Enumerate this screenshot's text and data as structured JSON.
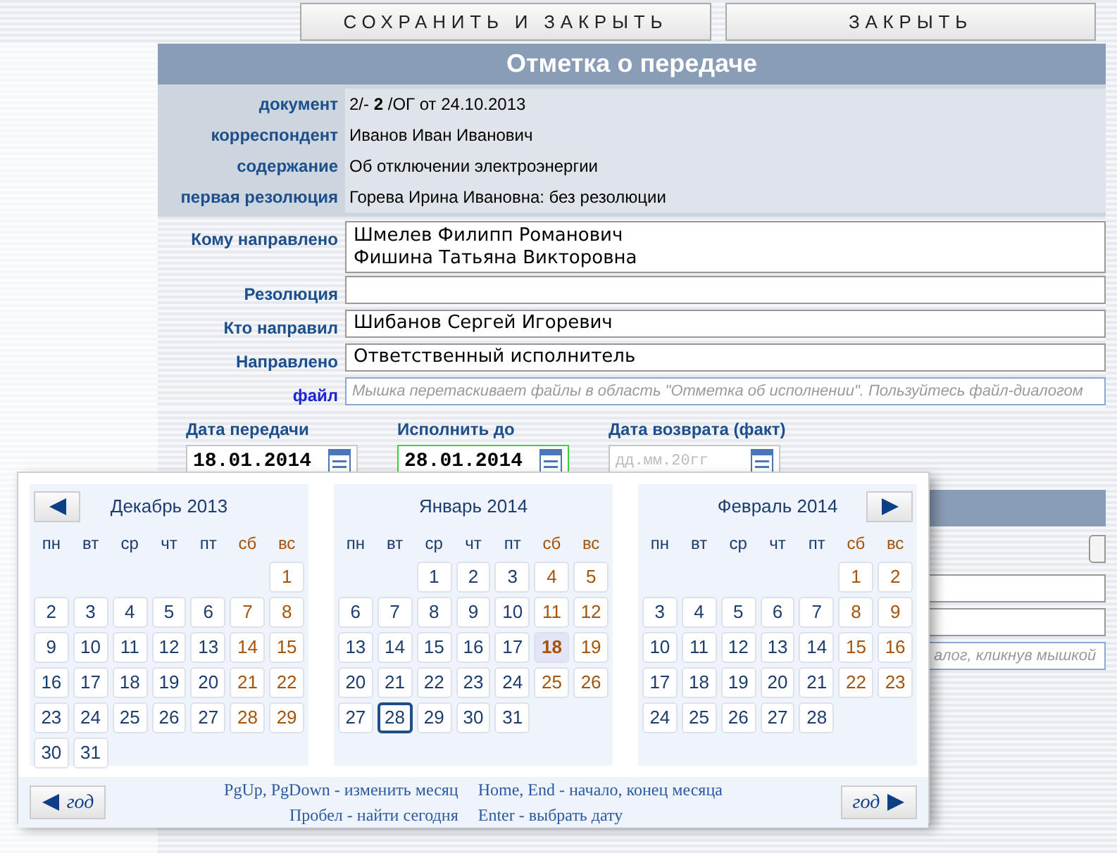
{
  "toolbar": {
    "buttons": [
      "СОХРАНИТЬ И ЗАКРЫТЬ",
      "ЗАКРЫТЬ"
    ]
  },
  "panel": {
    "title": "Отметка о передаче"
  },
  "info": [
    {
      "label": "документ",
      "value": "2/- **2** /ОГ от 24.10.2013"
    },
    {
      "label": "корреспондент",
      "value": "Иванов Иван Иванович"
    },
    {
      "label": "содержание",
      "value": "Об отключении электроэнергии"
    },
    {
      "label": "первая резолюция",
      "value": "Горева Ирина Ивановна: без резолюции"
    }
  ],
  "form": [
    {
      "label": "Кому направлено",
      "kind": "textarea",
      "lines": [
        "Шмелев Филипп Романович",
        "Фишина Татьяна Викторовна"
      ]
    },
    {
      "label": "Резолюция",
      "kind": "input"
    },
    {
      "label": "Кто направил",
      "kind": "input",
      "value": "Шибанов Сергей Игоревич"
    },
    {
      "label": "Направлено",
      "kind": "input",
      "value": "Ответственный исполнитель"
    },
    {
      "label": "файл",
      "kind": "file",
      "placeholder": "Мышка перетаскивает файлы в область \"Отметка об исполнении\". Пользуйтесь файл-диалогом"
    }
  ],
  "dates": [
    {
      "label": "Дата передачи",
      "value": "18.01.2014",
      "focused": false
    },
    {
      "label": "Исполнить до",
      "value": "28.01.2014",
      "focused": true
    },
    {
      "label": "Дата возврата (факт)",
      "placeholder": "дд.мм.20гг",
      "focused": false
    }
  ],
  "lower_section": {
    "file_placeholder_tail": "алог, кликнув мышкой"
  },
  "calendar": {
    "months": [
      {
        "title": "Декабрь 2013",
        "weekdays": [
          {
            "label": "пн",
            "weekend": false
          },
          {
            "label": "вт",
            "weekend": false
          },
          {
            "label": "ср",
            "weekend": false
          },
          {
            "label": "чт",
            "weekend": false
          },
          {
            "label": "пт",
            "weekend": false
          },
          {
            "label": "сб",
            "weekend": true
          },
          {
            "label": "вс",
            "weekend": true
          }
        ],
        "days": [
          {
            "kind": "empty"
          },
          {
            "kind": "empty"
          },
          {
            "kind": "empty"
          },
          {
            "kind": "empty"
          },
          {
            "kind": "empty"
          },
          {
            "kind": "empty"
          },
          {
            "day": "1",
            "selected": false,
            "today": false
          },
          {
            "day": "2",
            "selected": false,
            "today": false
          },
          {
            "day": "3",
            "selected": false,
            "today": false
          },
          {
            "day": "4",
            "selected": false,
            "today": false
          },
          {
            "day": "5",
            "selected": false,
            "today": false
          },
          {
            "day": "6",
            "selected": false,
            "today": false
          },
          {
            "day": "7",
            "selected": false,
            "today": false
          },
          {
            "day": "8",
            "selected": false,
            "today": false
          },
          {
            "day": "9",
            "selected": false,
            "today": false
          },
          {
            "day": "10",
            "selected": false,
            "today": false
          },
          {
            "day": "11",
            "selected": false,
            "today": false
          },
          {
            "day": "12",
            "selected": false,
            "today": false
          },
          {
            "day": "13",
            "selected": false,
            "today": false
          },
          {
            "day": "14",
            "selected": false,
            "today": false
          },
          {
            "day": "15",
            "selected": false,
            "today": false
          },
          {
            "day": "16",
            "selected": false,
            "today": false
          },
          {
            "day": "17",
            "selected": false,
            "today": false
          },
          {
            "day": "18",
            "selected": false,
            "today": false
          },
          {
            "day": "19",
            "selected": false,
            "today": false
          },
          {
            "day": "20",
            "selected": false,
            "today": false
          },
          {
            "day": "21",
            "selected": false,
            "today": false
          },
          {
            "day": "22",
            "selected": false,
            "today": false
          },
          {
            "day": "23",
            "selected": false,
            "today": false
          },
          {
            "day": "24",
            "selected": false,
            "today": false
          },
          {
            "day": "25",
            "selected": false,
            "today": false
          },
          {
            "day": "26",
            "selected": false,
            "today": false
          },
          {
            "day": "27",
            "selected": false,
            "today": false
          },
          {
            "day": "28",
            "selected": false,
            "today": false
          },
          {
            "day": "29",
            "selected": false,
            "today": false
          },
          {
            "day": "30",
            "selected": false,
            "today": false
          },
          {
            "day": "31",
            "selected": false,
            "today": false
          }
        ]
      },
      {
        "title": "Январь 2014",
        "weekdays": [
          {
            "label": "пн",
            "weekend": false
          },
          {
            "label": "вт",
            "weekend": false
          },
          {
            "label": "ср",
            "weekend": false
          },
          {
            "label": "чт",
            "weekend": false
          },
          {
            "label": "пт",
            "weekend": false
          },
          {
            "label": "сб",
            "weekend": true
          },
          {
            "label": "вс",
            "weekend": true
          }
        ],
        "days": [
          {
            "kind": "empty"
          },
          {
            "kind": "empty"
          },
          {
            "day": "1",
            "selected": false,
            "today": false
          },
          {
            "day": "2",
            "selected": false,
            "today": false
          },
          {
            "day": "3",
            "selected": false,
            "today": false
          },
          {
            "day": "4",
            "selected": false,
            "today": false
          },
          {
            "day": "5",
            "selected": false,
            "today": false
          },
          {
            "day": "6",
            "selected": false,
            "today": false
          },
          {
            "day": "7",
            "selected": false,
            "today": false
          },
          {
            "day": "8",
            "selected": false,
            "today": false
          },
          {
            "day": "9",
            "selected": false,
            "today": false
          },
          {
            "day": "10",
            "selected": false,
            "today": false
          },
          {
            "day": "11",
            "selected": false,
            "today": false
          },
          {
            "day": "12",
            "selected": false,
            "today": false
          },
          {
            "day": "13",
            "selected": false,
            "today": false
          },
          {
            "day": "14",
            "selected": false,
            "today": false
          },
          {
            "day": "15",
            "selected": false,
            "today": false
          },
          {
            "day": "16",
            "selected": false,
            "today": false
          },
          {
            "day": "17",
            "selected": false,
            "today": false
          },
          {
            "day": "18",
            "selected": false,
            "today": true
          },
          {
            "day": "19",
            "selected": false,
            "today": false
          },
          {
            "day": "20",
            "selected": false,
            "today": false
          },
          {
            "day": "21",
            "selected": false,
            "today": false
          },
          {
            "day": "22",
            "selected": false,
            "today": false
          },
          {
            "day": "23",
            "selected": false,
            "today": false
          },
          {
            "day": "24",
            "selected": false,
            "today": false
          },
          {
            "day": "25",
            "selected": false,
            "today": false
          },
          {
            "day": "26",
            "selected": false,
            "today": false
          },
          {
            "day": "27",
            "selected": false,
            "today": false
          },
          {
            "day": "28",
            "selected": true,
            "today": false
          },
          {
            "day": "29",
            "selected": false,
            "today": false
          },
          {
            "day": "30",
            "selected": false,
            "today": false
          },
          {
            "day": "31",
            "selected": false,
            "today": false
          }
        ]
      },
      {
        "title": "Февраль 2014",
        "weekdays": [
          {
            "label": "пн",
            "weekend": false
          },
          {
            "label": "вт",
            "weekend": false
          },
          {
            "label": "ср",
            "weekend": false
          },
          {
            "label": "чт",
            "weekend": false
          },
          {
            "label": "пт",
            "weekend": false
          },
          {
            "label": "сб",
            "weekend": true
          },
          {
            "label": "вс",
            "weekend": true
          }
        ],
        "days": [
          {
            "kind": "empty"
          },
          {
            "kind": "empty"
          },
          {
            "kind": "empty"
          },
          {
            "kind": "empty"
          },
          {
            "kind": "empty"
          },
          {
            "day": "1",
            "selected": false,
            "today": false
          },
          {
            "day": "2",
            "selected": false,
            "today": false
          },
          {
            "day": "3",
            "selected": false,
            "today": false
          },
          {
            "day": "4",
            "selected": false,
            "today": false
          },
          {
            "day": "5",
            "selected": false,
            "today": false
          },
          {
            "day": "6",
            "selected": false,
            "today": false
          },
          {
            "day": "7",
            "selected": false,
            "today": false
          },
          {
            "day": "8",
            "selected": false,
            "today": false
          },
          {
            "day": "9",
            "selected": false,
            "today": false
          },
          {
            "day": "10",
            "selected": false,
            "today": false
          },
          {
            "day": "11",
            "selected": false,
            "today": false
          },
          {
            "day": "12",
            "selected": false,
            "today": false
          },
          {
            "day": "13",
            "selected": false,
            "today": false
          },
          {
            "day": "14",
            "selected": false,
            "today": false
          },
          {
            "day": "15",
            "selected": false,
            "today": false
          },
          {
            "day": "16",
            "selected": false,
            "today": false
          },
          {
            "day": "17",
            "selected": false,
            "today": false
          },
          {
            "day": "18",
            "selected": false,
            "today": false
          },
          {
            "day": "19",
            "selected": false,
            "today": false
          },
          {
            "day": "20",
            "selected": false,
            "today": false
          },
          {
            "day": "21",
            "selected": false,
            "today": false
          },
          {
            "day": "22",
            "selected": false,
            "today": false
          },
          {
            "day": "23",
            "selected": false,
            "today": false
          },
          {
            "day": "24",
            "selected": false,
            "today": false
          },
          {
            "day": "25",
            "selected": false,
            "today": false
          },
          {
            "day": "26",
            "selected": false,
            "today": false
          },
          {
            "day": "27",
            "selected": false,
            "today": false
          },
          {
            "day": "28",
            "selected": false,
            "today": false
          }
        ]
      }
    ],
    "year_prev": "год",
    "year_next": "год",
    "hints": [
      [
        "PgUp, PgDown - изменить месяц",
        "Пробел - найти сегодня"
      ],
      [
        "Home, End - начало, конец месяца",
        "Enter - выбрать дату"
      ]
    ]
  }
}
